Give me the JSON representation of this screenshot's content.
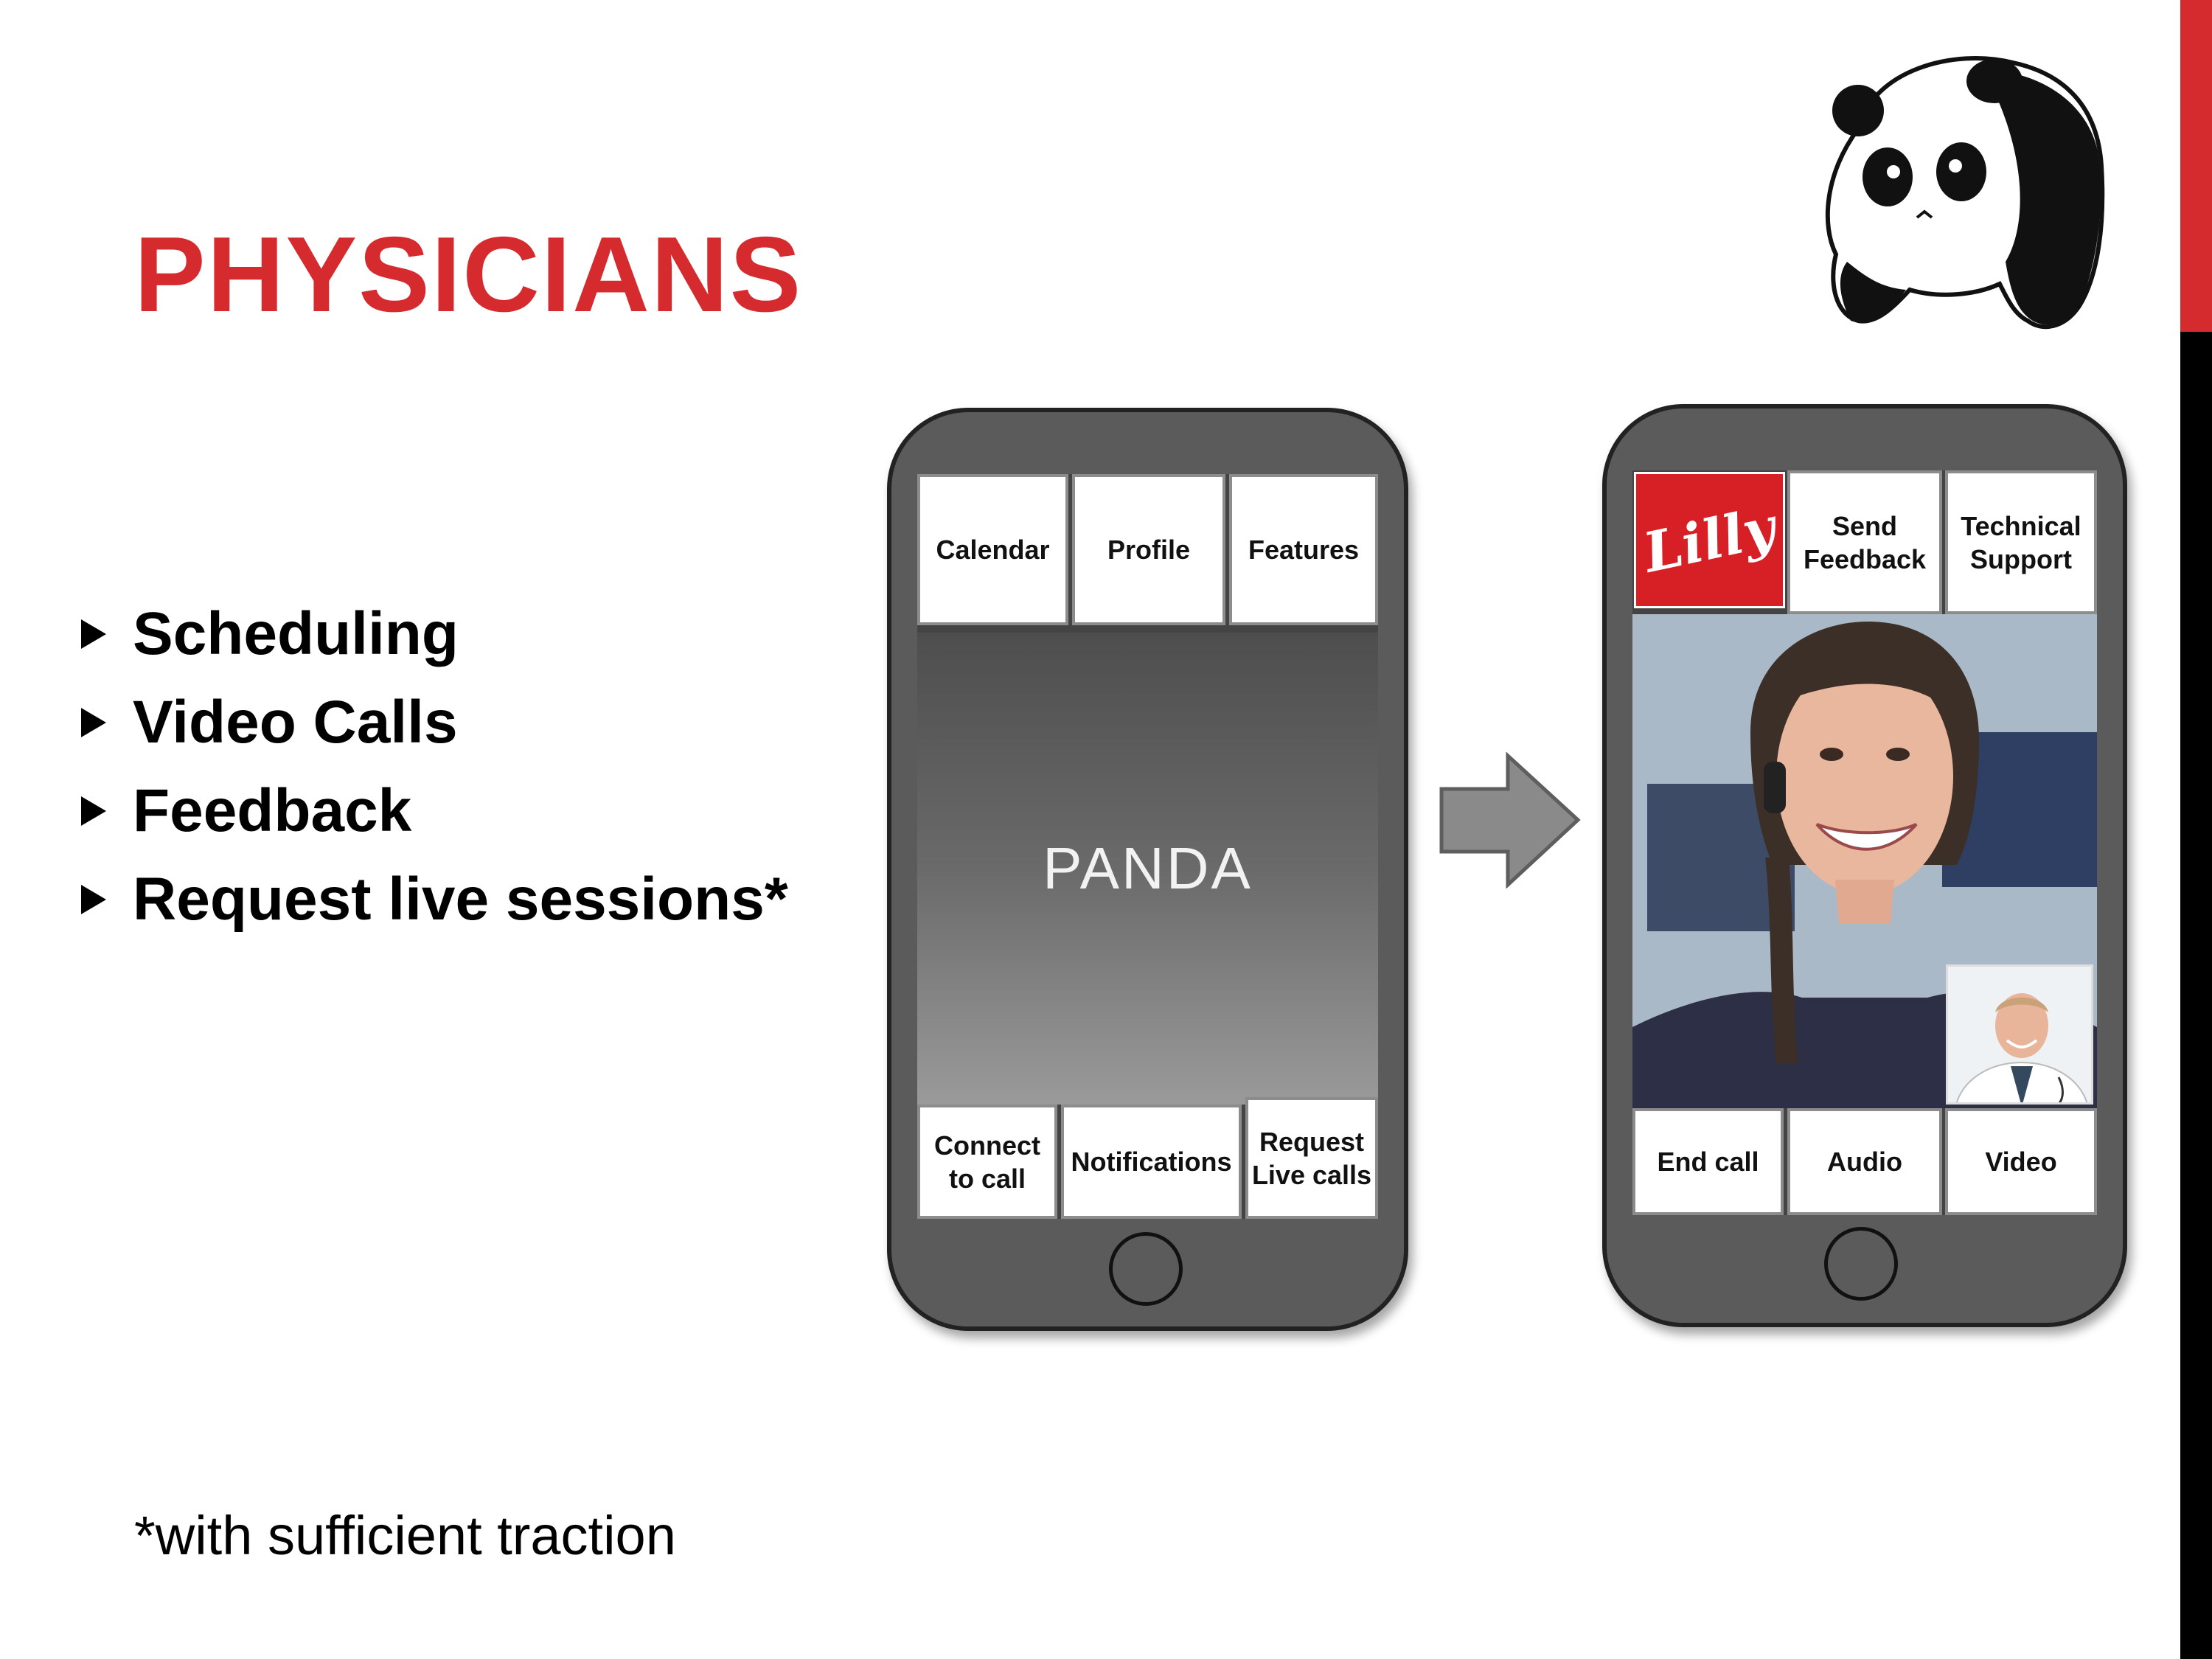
{
  "slide": {
    "title": "PHYSICIANS",
    "bullets": [
      "Scheduling",
      "Video Calls",
      "Feedback",
      "Request live sessions*"
    ],
    "footnote": "*with sufficient traction"
  },
  "phone_home": {
    "top_buttons": [
      "Calendar",
      "Profile",
      "Features"
    ],
    "splash_text": "PANDA",
    "bottom_buttons": [
      "Connect to call",
      "Notifications",
      "Request Live calls"
    ]
  },
  "phone_call": {
    "logo_text": "Lilly",
    "top_buttons": [
      "Send Feedback",
      "Technical Support"
    ],
    "bottom_buttons": [
      "End call",
      "Audio",
      "Video"
    ]
  },
  "colors": {
    "accent": "#d52b2f",
    "phone_body": "#5b5b5b",
    "arrow": "#8a8a8a"
  },
  "icons": {
    "logo": "panda-mascot-icon",
    "arrow": "right-arrow-icon"
  }
}
